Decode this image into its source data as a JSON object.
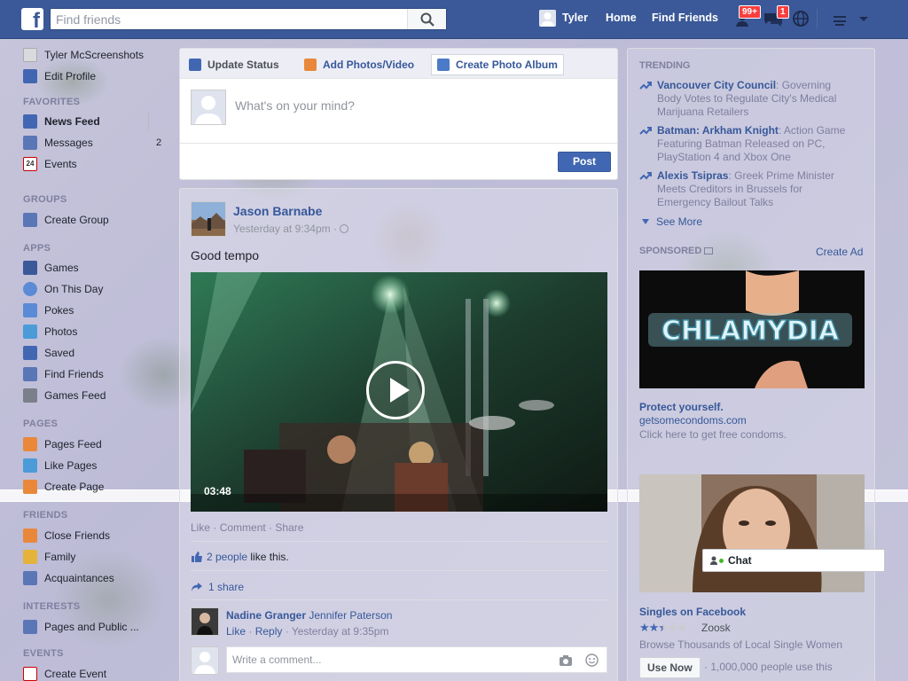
{
  "topbar": {
    "logo": "f",
    "search_placeholder": "Find friends",
    "profile_name": "Tyler",
    "home": "Home",
    "find_friends": "Find Friends",
    "friend_requests_badge": "99+",
    "messages_badge": "1"
  },
  "leftnav": {
    "profile": "Tyler McScreenshots",
    "edit_profile": "Edit Profile",
    "favorites_header": "FAVORITES",
    "news_feed": "News Feed",
    "messages": "Messages",
    "messages_count": "2",
    "events": "Events",
    "events_icon_text": "24",
    "groups_header": "GROUPS",
    "create_group": "Create Group",
    "apps_header": "APPS",
    "games": "Games",
    "on_this_day": "On This Day",
    "pokes": "Pokes",
    "photos": "Photos",
    "saved": "Saved",
    "find_friends": "Find Friends",
    "games_feed": "Games Feed",
    "pages_header": "PAGES",
    "pages_feed": "Pages Feed",
    "like_pages": "Like Pages",
    "create_page": "Create Page",
    "friends_header": "FRIENDS",
    "close_friends": "Close Friends",
    "family": "Family",
    "acquaintances": "Acquaintances",
    "interests_header": "INTERESTS",
    "pages_public": "Pages and Public ...",
    "events_header": "EVENTS",
    "create_event": "Create Event"
  },
  "composer": {
    "tab_status": "Update Status",
    "tab_photos": "Add Photos/Video",
    "tab_album": "Create Photo Album",
    "placeholder": "What's on your mind?",
    "post": "Post"
  },
  "story": {
    "author": "Jason Barnabe",
    "time": "Yesterday at 9:34pm · ",
    "text": "Good tempo",
    "video_duration": "03:48",
    "like": "Like",
    "comment": "Comment",
    "share": "Share",
    "sep": " · ",
    "likes_link": "2 people",
    "likes_tail": " like this.",
    "shares": "1 share",
    "comment_author": "Nadine Granger",
    "comment_text": "Jennifer Paterson",
    "comment_like": "Like",
    "comment_reply": "Reply",
    "comment_time": "Yesterday at 9:35pm",
    "write_comment": "Write a comment..."
  },
  "right": {
    "trending_header": "TRENDING",
    "trends": [
      {
        "title": "Vancouver City Council",
        "desc": ": Governing Body Votes to Regulate City's Medical Marijuana Retailers"
      },
      {
        "title": "Batman: Arkham Knight",
        "desc": ": Action Game Featuring Batman Released on PC, PlayStation 4 and Xbox One"
      },
      {
        "title": "Alexis Tsipras",
        "desc": ": Greek Prime Minister Meets Creditors in Brussels for Emergency Bailout Talks"
      }
    ],
    "see_more": "See More",
    "sponsored_header": "SPONSORED",
    "create_ad": "Create Ad",
    "ad1_image_text": "CHLAMYDIA",
    "ad1_title": "Protect yourself.",
    "ad1_url": "getsomecondoms.com",
    "ad1_desc": "Click here to get free condoms.",
    "ad2_title": "Singles on Facebook",
    "ad2_rating": 2.5,
    "ad2_brand": "Zoosk",
    "ad2_desc": "Browse Thousands of Local Single Women",
    "ad2_button": "Use Now",
    "ad2_meta": "· 1,000,000 people use this"
  },
  "chat": {
    "label": "Chat"
  },
  "colors": {
    "brand": "#3b5998",
    "link": "#365899",
    "button": "#4267b2",
    "badge": "#fa3e3e"
  }
}
